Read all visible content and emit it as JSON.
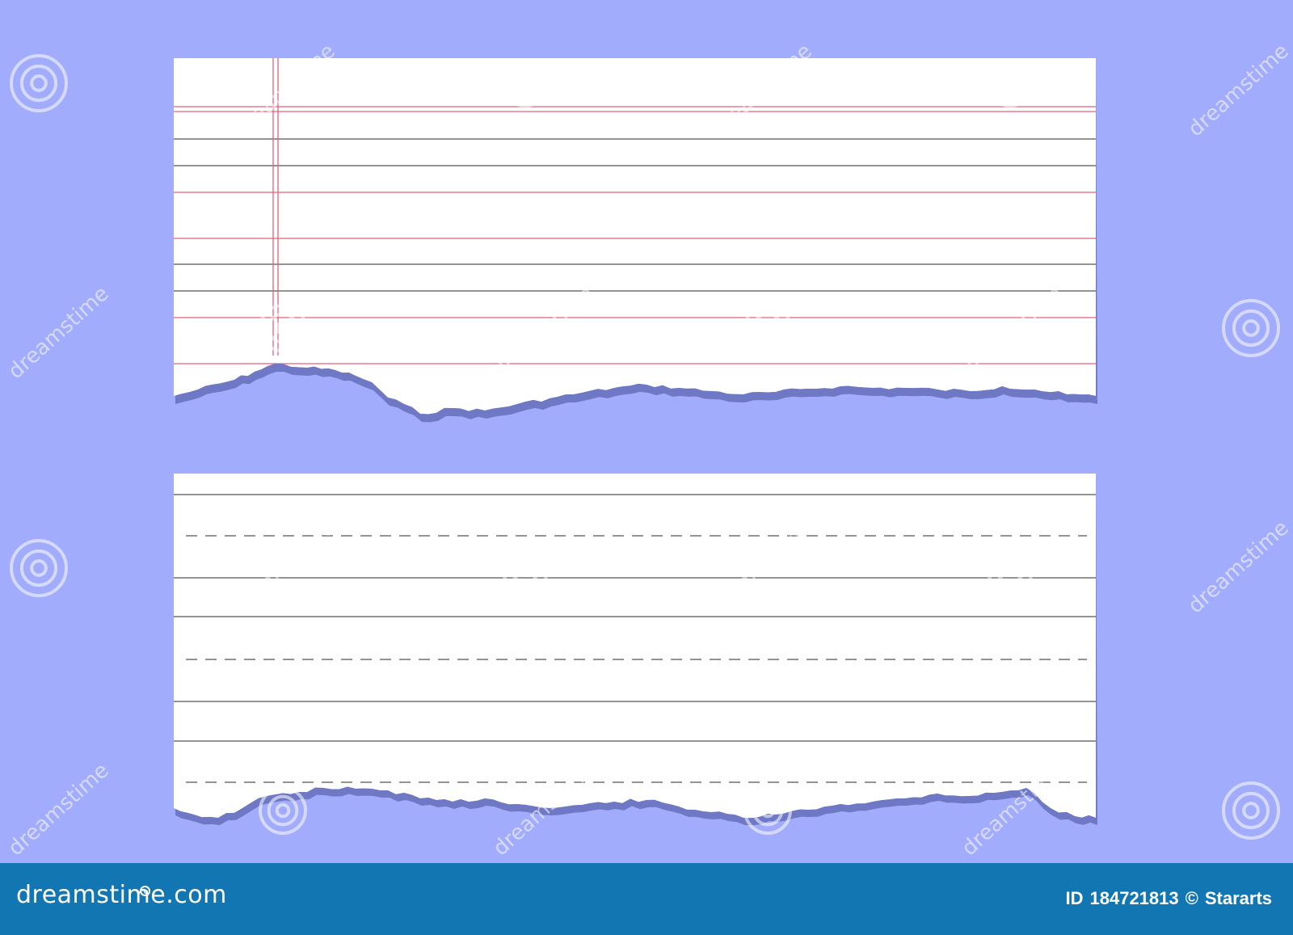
{
  "colors": {
    "background": "#a2acfc",
    "paper": "#ffffff",
    "torn_shadow": "#6f78c4",
    "red_rule": "#e4607a",
    "dark_rule": "#555555",
    "footer": "#1276b3",
    "watermark": "#ffffff"
  },
  "papers": [
    {
      "name": "lined-paper-with-margin",
      "style": "ruled, red margin double line, red and black horizontal rules",
      "edge": "torn bottom"
    },
    {
      "name": "handwriting-practice-paper",
      "style": "solid lines with dashed midlines",
      "edge": "torn bottom"
    }
  ],
  "watermark": {
    "icon": "spiral-logo-icon",
    "text": "dreamstime"
  },
  "footer": {
    "brand": "dreamstime.com",
    "id_label": "ID",
    "id_number": "184721813",
    "copyright_symbol": "©",
    "author": "Stararts"
  }
}
